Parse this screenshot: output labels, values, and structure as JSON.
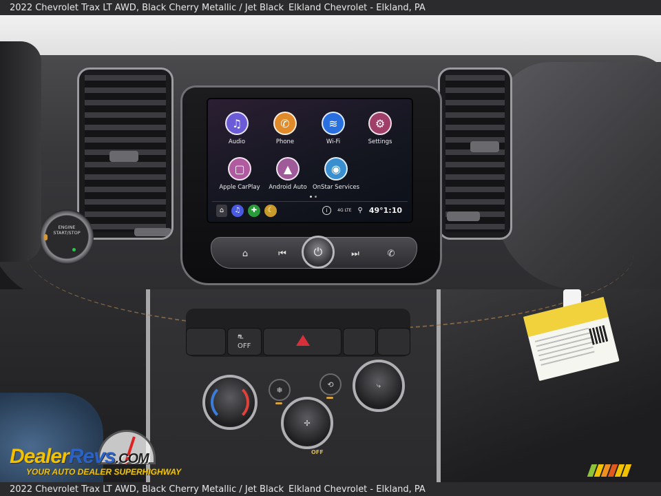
{
  "caption": {
    "vehicle": "2022 Chevrolet Trax LT AWD,  Black Cherry Metallic / Jet Black",
    "dealer": "Elkland Chevrolet - Elkland, PA"
  },
  "caption_bottom": {
    "vehicle": "2022 Chevrolet Trax LT AWD,  Black Cherry Metallic / Jet Black",
    "dealer": "Elkland Chevrolet - Elkland, PA"
  },
  "infotainment": {
    "apps": [
      {
        "label": "Audio",
        "icon": "music-note-icon",
        "glyph": "♫",
        "color": "#6b5bd6"
      },
      {
        "label": "Phone",
        "icon": "phone-icon",
        "glyph": "✆",
        "color": "#e08a2a"
      },
      {
        "label": "Wi-Fi",
        "icon": "wifi-icon",
        "glyph": "≋",
        "color": "#2a6fe0"
      },
      {
        "label": "Settings",
        "icon": "gear-icon",
        "glyph": "⚙",
        "color": "#a0406a"
      },
      {
        "label": "Apple CarPlay",
        "icon": "carplay-icon",
        "glyph": "▢",
        "color": "#b05aa0"
      },
      {
        "label": "Android Auto",
        "icon": "android-auto-icon",
        "glyph": "▲",
        "color": "#a05a9a"
      },
      {
        "label": "OnStar Services",
        "icon": "onstar-icon",
        "glyph": "◉",
        "color": "#3a8fd0"
      }
    ],
    "status": {
      "network": "4G LTE",
      "readout": "49°1:10",
      "info_glyph": "i"
    },
    "tray": [
      {
        "icon": "home-icon",
        "glyph": "⌂",
        "color": "#3a3a40"
      },
      {
        "icon": "music-note-icon",
        "glyph": "♫",
        "color": "#4a5ae0"
      },
      {
        "icon": "plus-icon",
        "glyph": "✚",
        "color": "#2a9a3a"
      },
      {
        "icon": "moon-icon",
        "glyph": "☾",
        "color": "#c89a2a"
      }
    ]
  },
  "controls": {
    "engine_button_label": "ENGINE START/STOP",
    "climate_off_label": "OFF",
    "esc_label": "OFF"
  },
  "watermark": {
    "logo_part1": "Dealer",
    "logo_part2": "Revs",
    "logo_suffix": ".COM",
    "tagline": "YOUR AUTO DEALER SUPERHIGHWAY",
    "gauge_digits": "2 4 5 6"
  },
  "stripe_colors": [
    "#8fc33a",
    "#f2c200",
    "#f09020",
    "#e05a20",
    "#f2c200",
    "#f2c200"
  ]
}
